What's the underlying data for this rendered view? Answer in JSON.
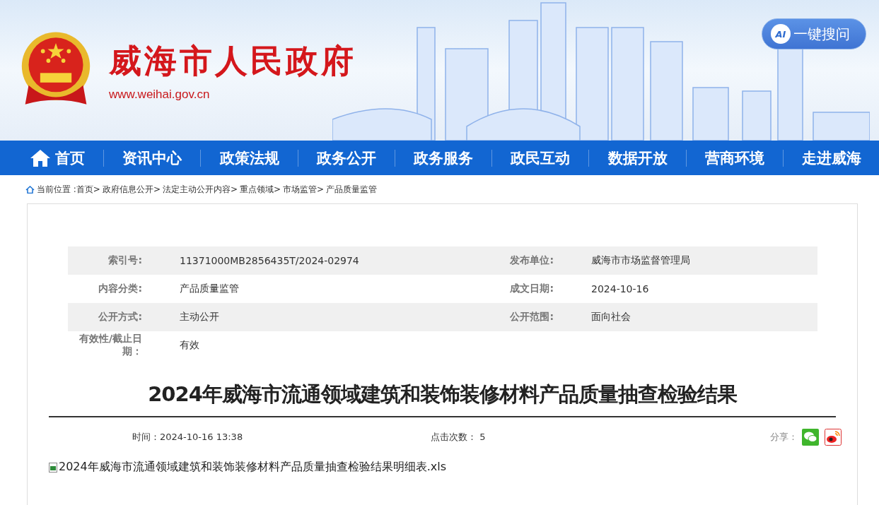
{
  "header": {
    "site_name": "威海市人民政府",
    "site_url": "www.weihai.gov.cn",
    "search_button": "一键搜问",
    "search_badge": "AI"
  },
  "nav": [
    {
      "label": "首页",
      "kind": "home"
    },
    {
      "label": "资讯中心",
      "kind": "plain"
    },
    {
      "label": "政策法规",
      "kind": "plain"
    },
    {
      "label": "政务公开",
      "kind": "plain"
    },
    {
      "label": "政务服务",
      "kind": "plain"
    },
    {
      "label": "政民互动",
      "kind": "plain"
    },
    {
      "label": "数据开放",
      "kind": "plain"
    },
    {
      "label": "营商环境",
      "kind": "plain"
    },
    {
      "label": "走进威海",
      "kind": "plain"
    }
  ],
  "breadcrumb": {
    "label": "当前位置 :",
    "separator": ">",
    "items": [
      "首页",
      "政府信息公开",
      "法定主动公开内容",
      "重点领域",
      "市场监管",
      "产品质量监管"
    ]
  },
  "info_table": [
    {
      "label": "索引号:",
      "value": "11371000MB2856435T/2024-02974",
      "label_2": "发布单位:",
      "value_2": "威海市市场监督管理局"
    },
    {
      "label": "内容分类:",
      "value": "产品质量监管",
      "label_2": "成文日期:",
      "value_2": "2024-10-16"
    },
    {
      "label": "公开方式:",
      "value": "主动公开",
      "label_2": "公开范围:",
      "value_2": "面向社会"
    },
    {
      "label": "有效性/截止日期：",
      "value": "有效"
    }
  ],
  "article": {
    "title": "2024年威海市流通领域建筑和装饰装修材料产品质量抽查检验结果",
    "time": "时间：2024-10-16 13:38",
    "views": "点击次数： 5",
    "share_label": "分享：",
    "attachment": "2024年威海市流通领域建筑和装饰装修材料产品质量抽查检验结果明细表.xls"
  }
}
